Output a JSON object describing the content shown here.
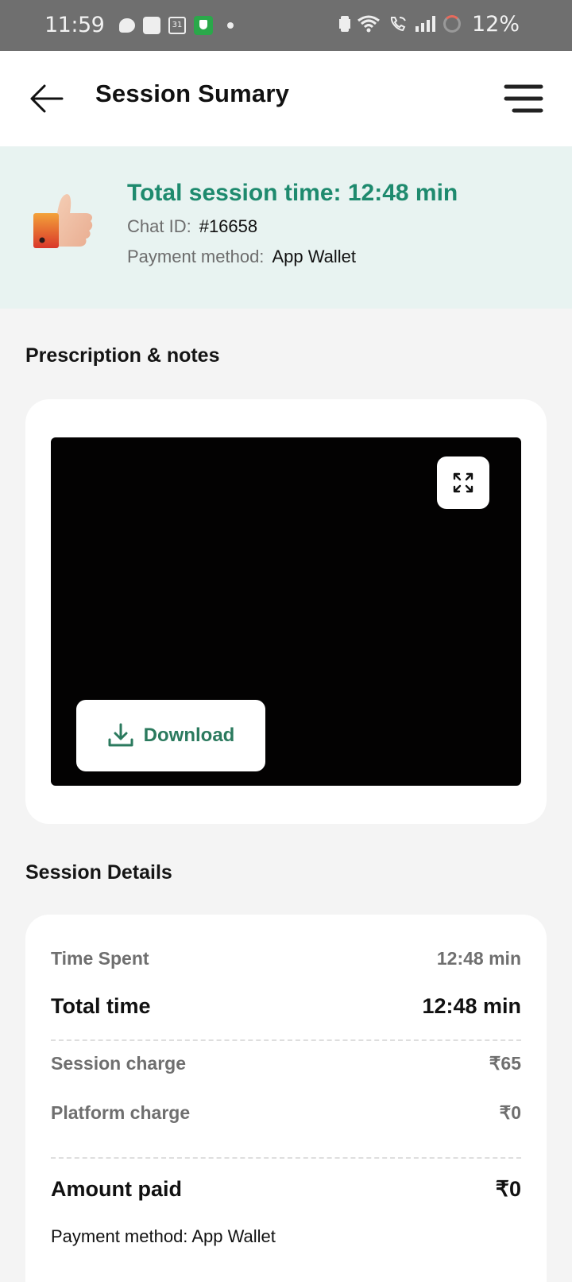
{
  "status_bar": {
    "time": "11:59",
    "calendar_day": "31",
    "battery_percent": "12%",
    "icons": [
      "chat-bubble-icon",
      "square-app-icon",
      "calendar-icon",
      "shield-icon",
      "dot-icon",
      "vibrate-icon",
      "wifi-icon",
      "wifi-calling-icon",
      "signal-icon",
      "battery-ring-icon"
    ]
  },
  "header": {
    "title": "Session Sumary",
    "back_icon": "arrow-left-icon",
    "menu_icon": "hamburger-menu-icon"
  },
  "summary": {
    "icon": "thumbs-up-icon",
    "title": "Total session time:  12:48 min",
    "chat_id_label": "Chat ID:",
    "chat_id_value": "#16658",
    "payment_label": "Payment method:",
    "payment_value": "App Wallet",
    "accent_color": "#1e8a6e"
  },
  "prescription": {
    "section_title": "Prescription & notes",
    "expand_icon": "expand-icon",
    "download_icon": "download-icon",
    "download_label": "Download"
  },
  "session_details": {
    "section_title": "Session Details",
    "time_spent_label": "Time Spent",
    "time_spent_value": "12:48 min",
    "total_time_label": "Total time",
    "total_time_value": "12:48 min",
    "session_charge_label": "Session charge",
    "session_charge_value": "₹65",
    "platform_charge_label": "Platform charge",
    "platform_charge_value": "₹0",
    "amount_paid_label": "Amount paid",
    "amount_paid_value": "₹0",
    "payment_method_text": "Payment method:  App Wallet"
  }
}
